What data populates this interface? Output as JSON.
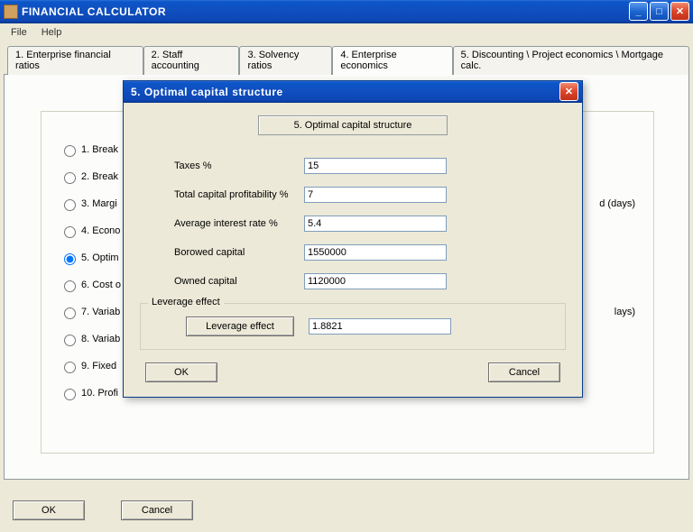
{
  "window": {
    "title": "FINANCIAL CALCULATOR",
    "menu": {
      "file": "File",
      "help": "Help"
    }
  },
  "tabs": [
    {
      "label": "1. Enterprise financial ratios"
    },
    {
      "label": "2. Staff accounting"
    },
    {
      "label": "3. Solvency ratios"
    },
    {
      "label": "4. Enterprise economics"
    },
    {
      "label": "5. Discounting \\ Project economics \\ Mortgage calc."
    }
  ],
  "radios": [
    {
      "label": "1. Break",
      "hint": ""
    },
    {
      "label": "2. Break",
      "hint": ""
    },
    {
      "label": "3. Margi",
      "hint": "d (days)"
    },
    {
      "label": "4. Econo",
      "hint": ""
    },
    {
      "label": "5. Optim",
      "hint": ""
    },
    {
      "label": "6. Cost o",
      "hint": ""
    },
    {
      "label": "7. Variab",
      "hint": "lays)"
    },
    {
      "label": "8. Variab",
      "hint": ""
    },
    {
      "label": "9. Fixed",
      "hint": ""
    },
    {
      "label": "10. Profi",
      "hint": ""
    }
  ],
  "buttons": {
    "ok": "OK",
    "cancel": "Cancel"
  },
  "modal": {
    "title": "5. Optimal capital structure",
    "header_btn": "5. Optimal capital structure",
    "fields": {
      "taxes_label": "Taxes %",
      "taxes_value": "15",
      "profit_label": "Total capital profitability %",
      "profit_value": "7",
      "interest_label": "Average interest rate %",
      "interest_value": "5.4",
      "borrowed_label": "Borowed capital",
      "borrowed_value": "1550000",
      "owned_label": "Owned capital",
      "owned_value": "1120000"
    },
    "group": {
      "legend": "Leverage effect",
      "btn": "Leverage effect",
      "value": "1.8821"
    },
    "ok": "OK",
    "cancel": "Cancel"
  }
}
